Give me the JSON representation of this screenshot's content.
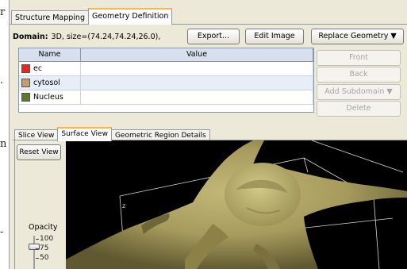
{
  "edge_text": {
    "a": "r",
    "b": ".",
    "c": "n",
    "d": "-"
  },
  "tabs": {
    "structure_mapping": "Structure Mapping",
    "geometry_definition": "Geometry Definition"
  },
  "domain": {
    "label": "Domain:",
    "value": "3D,  size=(74.24,74.24,26.0),"
  },
  "toolbar": {
    "export": "Export...",
    "edit_image": "Edit Image",
    "replace_geometry": "Replace Geometry ▼"
  },
  "subdomain_table": {
    "columns": [
      "Name",
      "Value"
    ],
    "rows": [
      {
        "name": "ec",
        "value": "",
        "color": "#e8261c"
      },
      {
        "name": "cytosol",
        "value": "",
        "color": "#c39f6f"
      },
      {
        "name": "Nucleus",
        "value": "",
        "color": "#5e7a2e"
      }
    ]
  },
  "side_buttons": {
    "front": "Front",
    "back": "Back",
    "add_subdomain": "Add Subdomain ▼",
    "delete": "Delete"
  },
  "view_tabs": {
    "slice": "Slice View",
    "surface": "Surface View",
    "regions": "Geometric Region Details"
  },
  "view_controls": {
    "reset": "Reset View",
    "opacity_label": "Opacity",
    "ticks": [
      "100",
      "75",
      "50"
    ],
    "opacity_percent": 75
  },
  "axis_label": "z",
  "colors": {
    "active_tab_accent": "#f7b84b",
    "cell_surface": "#a69a5c",
    "viewport_bg": "#000000"
  }
}
